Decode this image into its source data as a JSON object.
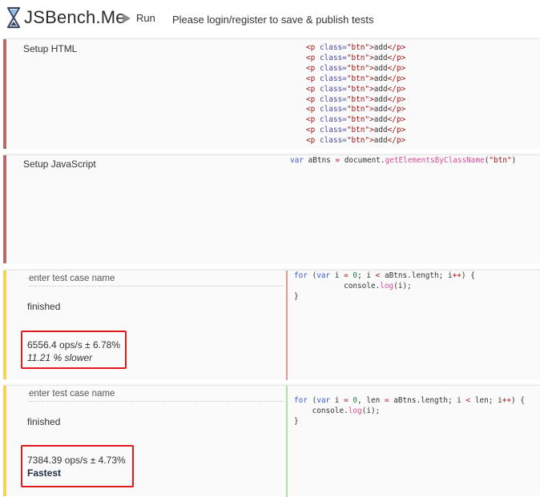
{
  "header": {
    "logo_text": "JSBench.Me",
    "run_label": "Run",
    "login_note": "Please login/register to save & publish tests"
  },
  "setup_html": {
    "label": "Setup HTML",
    "line_count": 10,
    "line": {
      "open_tag": "<p",
      "attr_name": "class=",
      "attr_value": "\"btn\"",
      "close_bracket": ">",
      "text": "add",
      "end_tag": "</p>"
    }
  },
  "setup_js": {
    "label": "Setup JavaScript",
    "code": {
      "kw": "var",
      "name": " aBtns ",
      "op": "=",
      "obj": " document.",
      "fn": "getElementsByClassName",
      "paren_open": "(",
      "arg": "\"btn\"",
      "paren_close": ")"
    }
  },
  "test_cases": [
    {
      "placeholder": "enter test case name",
      "status": "finished",
      "ops": "6556.4 ops/s ± 6.78%",
      "comparison": "11.21 % slower",
      "code": {
        "l1_kw_for": "for",
        "l1_paren": " (",
        "l1_kw_var": "var",
        "l1_i": " i ",
        "l1_eq": "=",
        "l1_zero": " 0",
        "l1_semi1": "; i ",
        "l1_lt": "<",
        "l1_rest": " aBtns.length; i",
        "l1_inc": "++",
        "l1_end": ") {",
        "l2_obj": "console.",
        "l2_fn": "log",
        "l2_args": "(i);",
        "l3": "}"
      }
    },
    {
      "placeholder": "enter test case name",
      "status": "finished",
      "ops": "7384.39 ops/s ± 4.73%",
      "comparison": "Fastest",
      "code": {
        "l1_kw_for": "for",
        "l1_paren": " (",
        "l1_kw_var": "var",
        "l1_i": " i ",
        "l1_eq": "=",
        "l1_zero": " 0",
        "l1_mid": ", len ",
        "l1_eq2": "=",
        "l1_mid2": " aBtns.length; i ",
        "l1_lt": "<",
        "l1_rest": " len; i",
        "l1_inc": "++",
        "l1_end": ") {",
        "l2_obj": "console.",
        "l2_fn": "log",
        "l2_args": "(i);",
        "l3": "}"
      }
    }
  ],
  "colors": {
    "setup_stripe": "#b66a6a",
    "case_stripe": "#f3d35a",
    "slow_divider": "#e29a9a",
    "fast_divider": "#a9e2a3",
    "highlight_box": "#e0191e"
  }
}
